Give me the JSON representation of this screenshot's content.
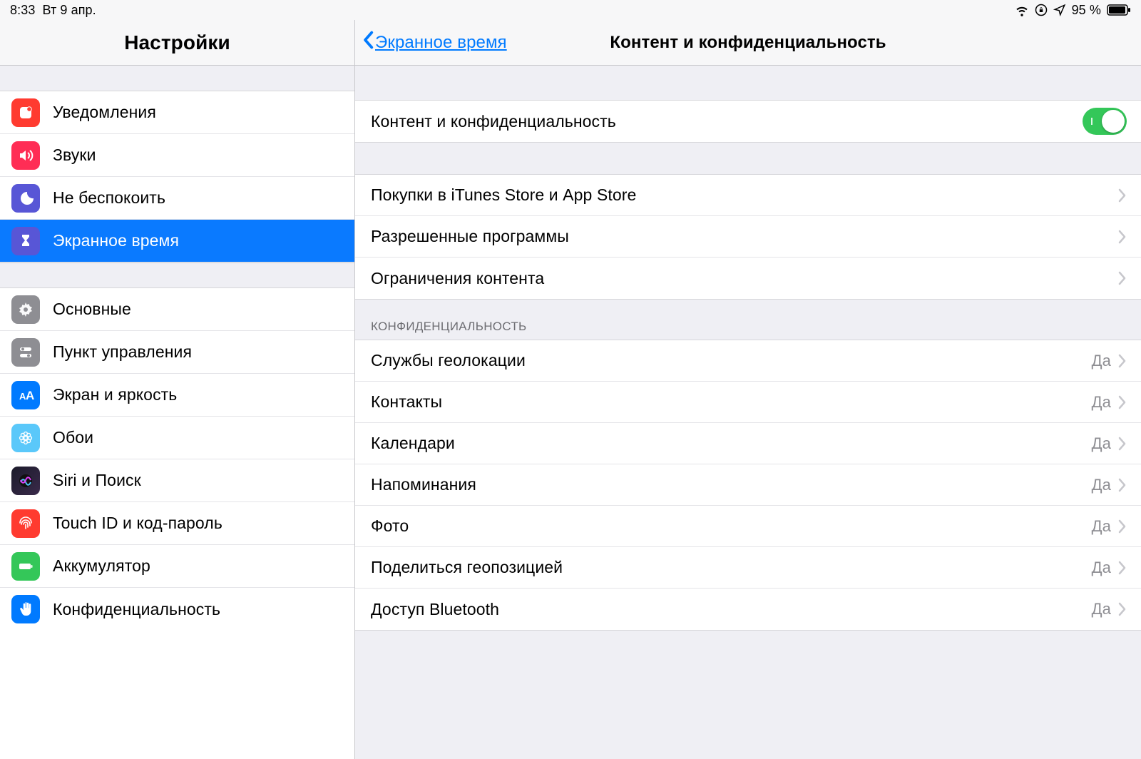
{
  "status": {
    "time": "8:33",
    "date": "Вт 9 апр.",
    "battery": "95 %"
  },
  "sidebar": {
    "title": "Настройки",
    "groups": [
      [
        {
          "id": "notifications",
          "label": "Уведомления",
          "icon": "notifications",
          "color": "ic-red"
        },
        {
          "id": "sounds",
          "label": "Звуки",
          "icon": "speaker",
          "color": "ic-pink"
        },
        {
          "id": "dnd",
          "label": "Не беспокоить",
          "icon": "moon",
          "color": "ic-purple"
        },
        {
          "id": "screentime",
          "label": "Экранное время",
          "icon": "hourglass",
          "color": "ic-purple",
          "selected": true
        }
      ],
      [
        {
          "id": "general",
          "label": "Основные",
          "icon": "gear",
          "color": "ic-gray"
        },
        {
          "id": "control",
          "label": "Пункт управления",
          "icon": "toggles",
          "color": "ic-gray"
        },
        {
          "id": "display",
          "label": "Экран и яркость",
          "icon": "text",
          "color": "ic-blue"
        },
        {
          "id": "wallpaper",
          "label": "Обои",
          "icon": "flower",
          "color": "ic-teal"
        },
        {
          "id": "siri",
          "label": "Siri и Поиск",
          "icon": "siri",
          "color": "ic-dark"
        },
        {
          "id": "touchid",
          "label": "Touch ID и код-пароль",
          "icon": "fingerprint",
          "color": "ic-red2"
        },
        {
          "id": "battery",
          "label": "Аккумулятор",
          "icon": "battery",
          "color": "ic-green"
        },
        {
          "id": "privacy",
          "label": "Конфиденциальность",
          "icon": "hand",
          "color": "ic-blue"
        }
      ]
    ]
  },
  "detail": {
    "back_label": "Экранное время",
    "title": "Контент и конфиденциальность",
    "sections": [
      {
        "rows": [
          {
            "label": "Контент и конфиденциальность",
            "kind": "switch",
            "on": true
          }
        ]
      },
      {
        "rows": [
          {
            "label": "Покупки в iTunes Store и App Store",
            "kind": "link"
          },
          {
            "label": "Разрешенные программы",
            "kind": "link"
          },
          {
            "label": "Ограничения контента",
            "kind": "link"
          }
        ]
      },
      {
        "header": "КОНФИДЕНЦИАЛЬНОСТЬ",
        "rows": [
          {
            "label": "Службы геолокации",
            "kind": "value",
            "value": "Да"
          },
          {
            "label": "Контакты",
            "kind": "value",
            "value": "Да"
          },
          {
            "label": "Календари",
            "kind": "value",
            "value": "Да"
          },
          {
            "label": "Напоминания",
            "kind": "value",
            "value": "Да"
          },
          {
            "label": "Фото",
            "kind": "value",
            "value": "Да"
          },
          {
            "label": "Поделиться геопозицией",
            "kind": "value",
            "value": "Да"
          },
          {
            "label": "Доступ Bluetooth",
            "kind": "value",
            "value": "Да"
          }
        ]
      }
    ]
  }
}
